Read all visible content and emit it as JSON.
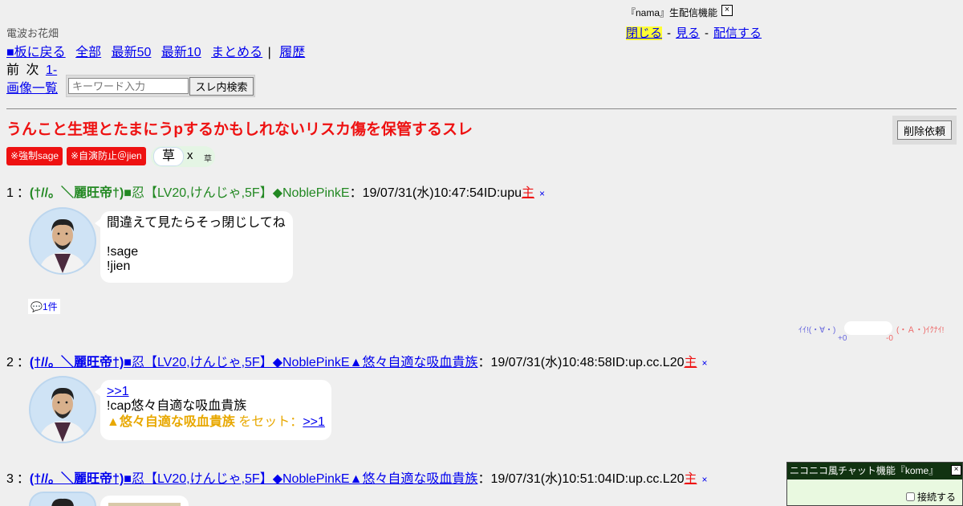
{
  "board_name": "電波お花畑",
  "nav": {
    "back_to_board": "■板に戻る",
    "all": "全部",
    "latest50": "最新50",
    "latest10": "最新10",
    "summarize": "まとめる",
    "separator": "|",
    "history": "履歴",
    "prev": "前",
    "next": "次",
    "range": "1-",
    "images": "画像一覧"
  },
  "search": {
    "placeholder": "キーワード入力",
    "button_label": "スレ内検索"
  },
  "nama": {
    "title": "『nama』生配信機能",
    "close": "×",
    "close_link": "閉じる",
    "view_link": "見る",
    "broadcast_link": "配信する",
    "dash": "-"
  },
  "thread": {
    "title": "うんこと生理とたまにうpするかもしれないリスカ傷を保管するスレ",
    "delete_request": "削除依頼",
    "badges": [
      "※強制sage",
      "※自演防止＠jien"
    ],
    "kusa": {
      "label": "草",
      "x": "x",
      "small": "草"
    }
  },
  "posts": [
    {
      "num": "1",
      "colon": "：",
      "name_bold": "(†//。＼麗旺帝†)",
      "name_rest": "■忍【LV20,けんじゃ,5F】◆NoblePinkE",
      "date": "：19/07/31(水)10:47:54",
      "id": "ID:upu",
      "owner": "主",
      "x": "×",
      "lines": [
        "間違えて見たらそっ閉じしてね",
        "",
        "!sage",
        "!jien"
      ]
    },
    {
      "num": "2",
      "colon": "：",
      "name_bold": "(†//。＼麗旺帝†)",
      "name_rest": "■忍【LV20,けんじゃ,5F】◆NoblePinkE▲悠々自適な吸血貴族",
      "date": "：19/07/31(水)10:48:58",
      "id": "ID:up.cc.L20",
      "owner": "主",
      "x": "×",
      "anchor": ">>1",
      "cap_command": "!cap悠々自適な吸血貴族",
      "cap_name": "▲悠々自適な吸血貴族",
      "cap_set": "をセット：",
      "cap_anchor": ">>1"
    },
    {
      "num": "3",
      "colon": "：",
      "name_bold": "(†//。＼麗旺帝†)",
      "name_rest": "■忍【LV20,けんじゃ,5F】◆NoblePinkE▲悠々自適な吸血貴族",
      "date": "：19/07/31(水)10:51:04",
      "id": "ID:up.cc.L20",
      "owner": "主",
      "x": "×"
    }
  ],
  "reply_count": "1件",
  "vote": {
    "ii_label": "ｲｲ!(・∀・)",
    "ikenai_label": "(・Ａ・)ｲｸﾅｲ!",
    "ii_count": "+0",
    "ikenai_count": "-0"
  },
  "kome": {
    "title": "ニコニコ風チャット機能『kome』",
    "close": "×",
    "connect_label": "接続する"
  }
}
